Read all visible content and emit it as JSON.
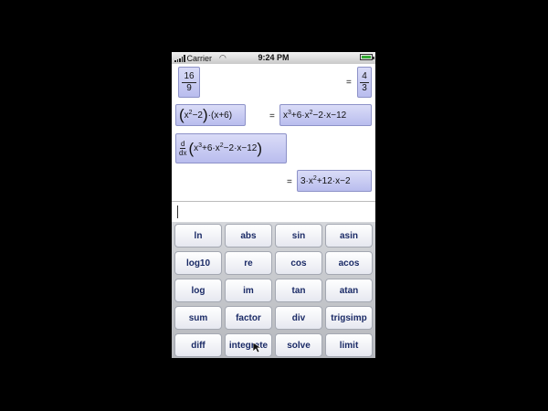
{
  "status": {
    "carrier": "Carrier",
    "time": "9:24 PM"
  },
  "history": [
    {
      "input": {
        "num": "16",
        "den": "9"
      },
      "result": {
        "num": "4",
        "den": "3"
      }
    },
    {
      "input": {
        "a": "x",
        "a_exp": "2",
        "b": "−2",
        "c": "(x+6)"
      },
      "result": {
        "t1": "x",
        "e1": "3",
        "t2": "+6·x",
        "e2": "2",
        "t3": "−2·x−12"
      }
    },
    {
      "input": {
        "d": "d",
        "dx": "dx",
        "t1": "x",
        "e1": "3",
        "t2": "+6·x",
        "e2": "2",
        "t3": "−2·x−12"
      },
      "result": {
        "t1": "3·x",
        "e1": "2",
        "t2": "+12·x−2"
      }
    }
  ],
  "equals": "=",
  "input": {
    "value": ""
  },
  "keys": [
    [
      "ln",
      "abs",
      "sin",
      "asin"
    ],
    [
      "log10",
      "re",
      "cos",
      "acos"
    ],
    [
      "log",
      "im",
      "tan",
      "atan"
    ],
    [
      "sum",
      "factor",
      "div",
      "trigsimp"
    ],
    [
      "diff",
      "integrate",
      "solve",
      "limit"
    ]
  ]
}
